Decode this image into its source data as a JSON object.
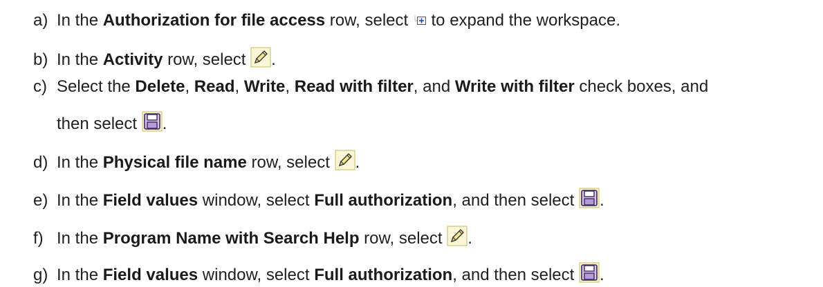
{
  "steps": [
    {
      "letter": "a)",
      "parts": [
        "In the ",
        "Authorization for file access",
        " row, select ",
        " to expand the workspace."
      ],
      "icon": "expand-node-icon"
    },
    {
      "letter": "b)",
      "parts": [
        "In the ",
        "Activity",
        " row, select ",
        "."
      ],
      "icon": "pencil-edit-icon"
    },
    {
      "letter": "c)",
      "parts": [
        "Select the ",
        "Delete",
        ", ",
        "Read",
        ", ",
        "Write",
        ", ",
        "Read with filter",
        ", and ",
        "Write with filter",
        " check boxes, and"
      ],
      "continuation": [
        "then select ",
        "."
      ],
      "icon": "save-floppy-icon"
    },
    {
      "letter": "d)",
      "parts": [
        "In the ",
        "Physical file name",
        " row, select ",
        "."
      ],
      "icon": "pencil-edit-icon"
    },
    {
      "letter": "e)",
      "parts": [
        "In the ",
        "Field values",
        " window, select ",
        "Full authorization",
        ", and then select ",
        "."
      ],
      "icon": "save-floppy-icon"
    },
    {
      "letter": "f)",
      "parts": [
        "In the ",
        "Program Name with Search Help",
        " row, select ",
        "."
      ],
      "icon": "pencil-edit-icon"
    },
    {
      "letter": "g)",
      "parts": [
        "In the ",
        "Field values",
        " window, select ",
        "Full authorization",
        ", and then select ",
        "."
      ],
      "icon": "save-floppy-icon"
    }
  ]
}
